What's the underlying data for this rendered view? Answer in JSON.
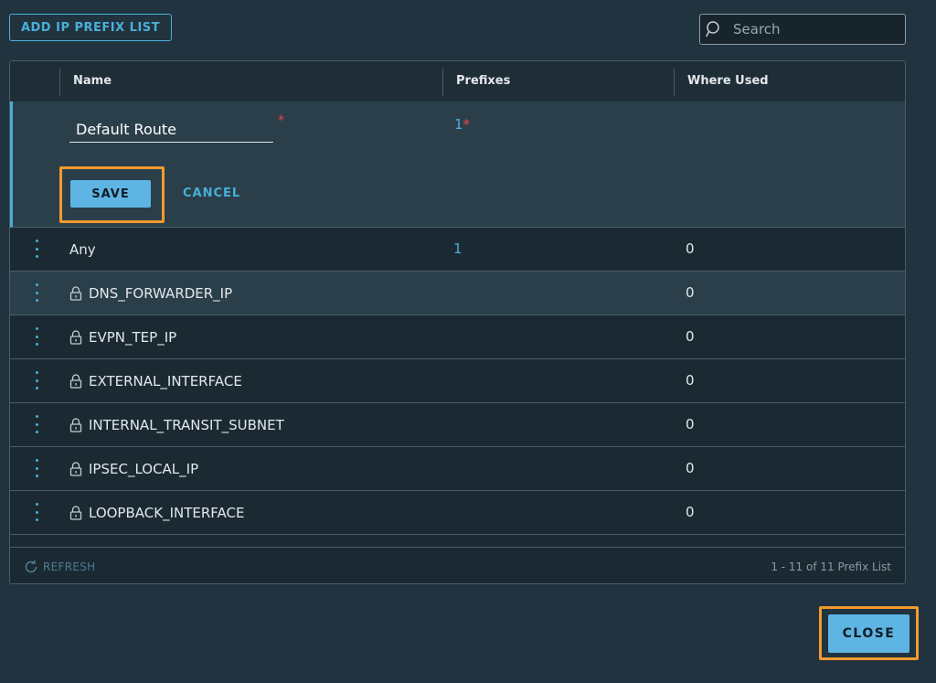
{
  "toolbar": {
    "add_label": "ADD IP PREFIX LIST",
    "search_placeholder": "Search"
  },
  "grid": {
    "columns": [
      "Name",
      "Prefixes",
      "Where Used"
    ],
    "edit_row": {
      "name_value": "Default Route",
      "required_mark": "*",
      "prefix_count": "1",
      "save_label": "SAVE",
      "cancel_label": "CANCEL"
    },
    "rows": [
      {
        "name": "Any",
        "locked": false,
        "prefixes": "1",
        "where_used": "0"
      },
      {
        "name": "DNS_FORWARDER_IP",
        "locked": true,
        "prefixes": "",
        "where_used": "0"
      },
      {
        "name": "EVPN_TEP_IP",
        "locked": true,
        "prefixes": "",
        "where_used": "0"
      },
      {
        "name": "EXTERNAL_INTERFACE",
        "locked": true,
        "prefixes": "",
        "where_used": "0"
      },
      {
        "name": "INTERNAL_TRANSIT_SUBNET",
        "locked": true,
        "prefixes": "",
        "where_used": "0"
      },
      {
        "name": "IPSEC_LOCAL_IP",
        "locked": true,
        "prefixes": "",
        "where_used": "0"
      },
      {
        "name": "LOOPBACK_INTERFACE",
        "locked": true,
        "prefixes": "",
        "where_used": "0"
      }
    ],
    "footer": {
      "refresh_label": "REFRESH",
      "pagination": "1 - 11 of 11 Prefix List"
    }
  },
  "dialog": {
    "close_label": "CLOSE"
  },
  "colors": {
    "accent": "#49afd9",
    "highlight": "#f39a2f",
    "required": "#f5424e",
    "background": "#21333e"
  },
  "icons": [
    "search-icon",
    "kebab-menu-icon",
    "lock-icon",
    "refresh-icon"
  ]
}
